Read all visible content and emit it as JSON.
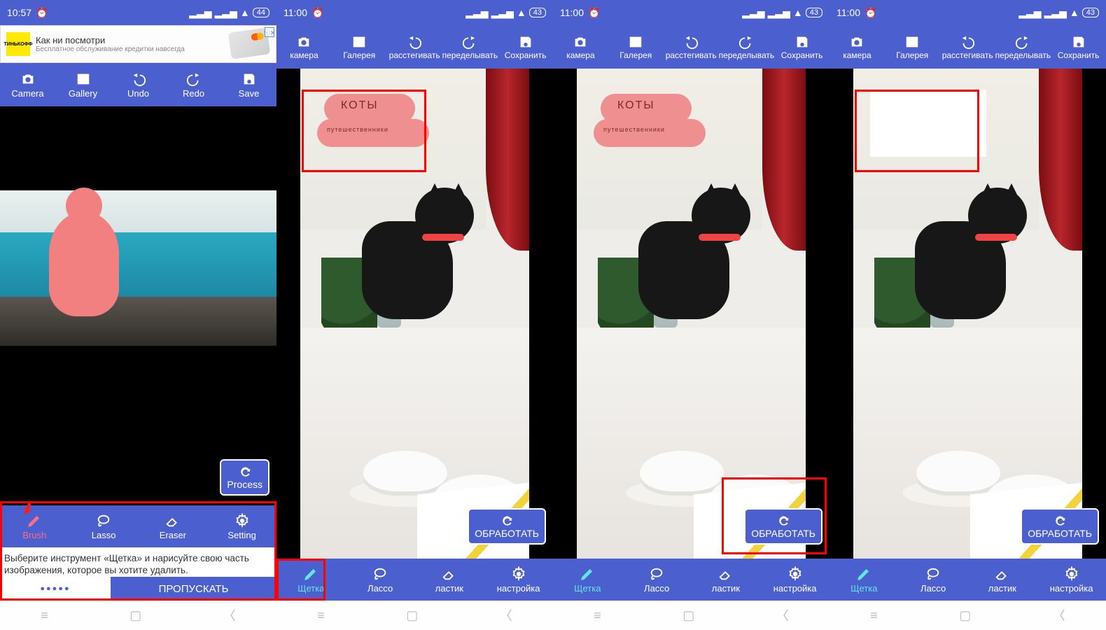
{
  "panels": [
    {
      "status": {
        "time": "10:57",
        "battery": "44"
      },
      "ad": {
        "brand": "ТИНЬКОФФ",
        "title": "Как ни посмотри",
        "sub": "Бесплатное обслуживание кредитки навсегда",
        "close": "✕",
        "badge": "ⓘ✕"
      },
      "toolbar": {
        "camera": "Camera",
        "gallery": "Gallery",
        "undo": "Undo",
        "redo": "Redo",
        "save": "Save"
      },
      "process": "Process",
      "bottom": {
        "brush": "Brush",
        "lasso": "Lasso",
        "eraser": "Eraser",
        "setting": "Setting"
      },
      "tip": "Выберите инструмент «Щетка» и нарисуйте свою часть изображения, которое вы хотите удалить.",
      "dots": "●●●●●",
      "skip": "ПРОПУСКАТЬ"
    },
    {
      "status": {
        "time": "11:00",
        "battery": "43"
      },
      "toolbar": {
        "camera": "камера",
        "gallery": "Галерея",
        "undo": "расстегивать",
        "redo": "переделывать",
        "save": "Сохранить"
      },
      "process": "ОБРАБОТАТЬ",
      "bottom": {
        "brush": "Щетка",
        "lasso": "Лассо",
        "eraser": "ластик",
        "setting": "настройка"
      },
      "mark": {
        "line1": "КОТЫ",
        "line2": "путешественники"
      }
    },
    {
      "status": {
        "time": "11:00",
        "battery": "43"
      },
      "toolbar": {
        "camera": "камера",
        "gallery": "Галерея",
        "undo": "расстегивать",
        "redo": "переделывать",
        "save": "Сохранить"
      },
      "process": "ОБРАБОТАТЬ",
      "bottom": {
        "brush": "Щетка",
        "lasso": "Лассо",
        "eraser": "ластик",
        "setting": "настройка"
      },
      "mark": {
        "line1": "КОТЫ",
        "line2": "путешественники"
      }
    },
    {
      "status": {
        "time": "11:00",
        "battery": "43"
      },
      "toolbar": {
        "camera": "камера",
        "gallery": "Галерея",
        "undo": "расстегивать",
        "redo": "переделывать",
        "save": "Сохранить"
      },
      "process": "ОБРАБОТАТЬ",
      "bottom": {
        "brush": "Щетка",
        "lasso": "Лассо",
        "eraser": "ластик",
        "setting": "настройка"
      }
    }
  ]
}
